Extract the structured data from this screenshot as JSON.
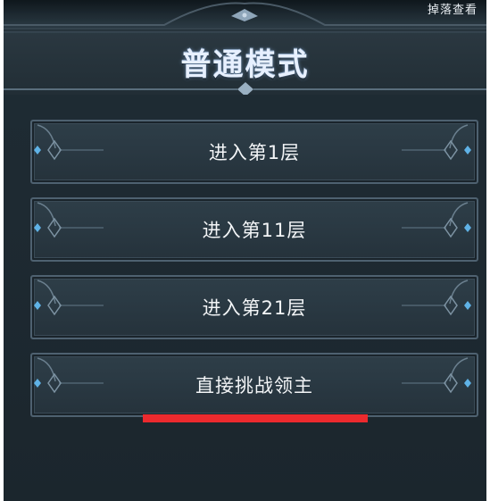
{
  "header": {
    "drop_link_label": "掉落查看"
  },
  "title": "普通模式",
  "buttons": [
    {
      "label": "进入第1层"
    },
    {
      "label": "进入第11层"
    },
    {
      "label": "进入第21层"
    },
    {
      "label": "直接挑战领主"
    }
  ],
  "colors": {
    "panel": "#1f2c34",
    "button_border": "#4e6170",
    "gem": "#5fb2e6",
    "highlight": "#ec2a2e"
  }
}
